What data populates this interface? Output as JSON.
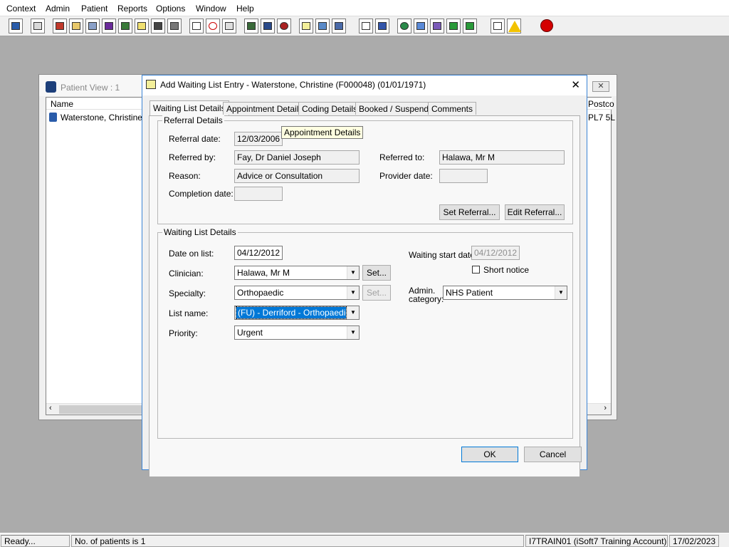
{
  "menu": [
    "Context",
    "Admin",
    "Patient",
    "Reports",
    "Options",
    "Window",
    "Help"
  ],
  "toolbar_icons": [
    "patient-icon",
    "print-icon",
    "books-icon",
    "edit-icon",
    "list-icon",
    "m-icon",
    "person-icon",
    "notes-icon",
    "flag-icon",
    "flag2-icon",
    "search-doc-icon",
    "clock-icon",
    "monitor-icon",
    "card-icon",
    "card2-icon",
    "dial-icon",
    "note-icon",
    "bed-icon",
    "ambulance-icon",
    "page-icon",
    "chart-icon",
    "globe-icon",
    "form-icon",
    "form2-icon",
    "arrow-down-icon",
    "arrow-right-icon",
    "swap-icon",
    "warning-icon",
    "exit-icon"
  ],
  "patient_view": {
    "title": "Patient View : 1",
    "col_name": "Name",
    "col_postcode": "Postco",
    "row_name": "Waterstone, Christine...",
    "row_postcode": "PL7 5L"
  },
  "dialog": {
    "title": "Add Waiting List Entry - Waterstone, Christine (F000048) (01/01/1971)",
    "close": "✕",
    "tabs": [
      "Waiting List Details",
      "Appointment Details",
      "Coding Details",
      "Booked / Suspend",
      "Comments"
    ],
    "tooltip": "Appointment Details",
    "referral": {
      "legend": "Referral Details",
      "referral_date_label": "Referral date:",
      "referral_date": "12/03/2006",
      "referred_by_label": "Referred by:",
      "referred_by": "Fay, Dr Daniel Joseph",
      "referred_to_label": "Referred to:",
      "referred_to": "Halawa, Mr M",
      "reason_label": "Reason:",
      "reason": "Advice or Consultation",
      "provider_date_label": "Provider date:",
      "provider_date": "",
      "completion_date_label": "Completion date:",
      "completion_date": "",
      "set_referral": "Set Referral...",
      "edit_referral": "Edit Referral..."
    },
    "waiting": {
      "legend": "Waiting List Details",
      "date_on_list_label": "Date on list:",
      "date_on_list": "04/12/2012",
      "waiting_start_label": "Waiting start date:",
      "waiting_start": "04/12/2012",
      "short_notice_label": "Short notice",
      "clinician_label": "Clinician:",
      "clinician": "Halawa, Mr M",
      "set_clinician": "Set...",
      "specialty_label": "Specialty:",
      "specialty": "Orthopaedic",
      "set_specialty": "Set...",
      "admin_category_label_1": "Admin.",
      "admin_category_label_2": "category:",
      "admin_category": "NHS Patient",
      "list_name_label": "List name:",
      "list_name": "(FU) - Derriford - Orthopaedic OP",
      "priority_label": "Priority:",
      "priority": "Urgent"
    },
    "ok": "OK",
    "cancel": "Cancel"
  },
  "status": {
    "ready": "Ready...",
    "patients": "No. of patients is 1",
    "account": "I7TRAIN01 (iSoft7 Training Account)",
    "date": "17/02/2023"
  }
}
